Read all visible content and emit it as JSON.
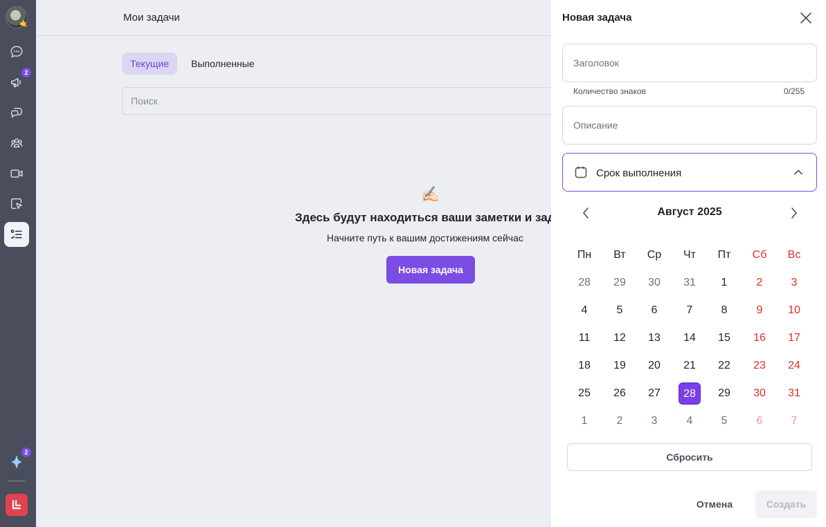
{
  "sidebar": {
    "avatar_badge": "🤙",
    "items": [
      {
        "name": "chat-icon"
      },
      {
        "name": "megaphone-icon",
        "badge": "2"
      },
      {
        "name": "comments-icon"
      },
      {
        "name": "groups-icon"
      },
      {
        "name": "video-icon"
      },
      {
        "name": "pointer-board-icon"
      },
      {
        "name": "tasks-icon",
        "active": true
      }
    ],
    "assistant_badge": "2"
  },
  "main": {
    "title": "Мои задачи",
    "tabs": [
      {
        "label": "Текущие",
        "active": true
      },
      {
        "label": "Выполненные",
        "active": false
      }
    ],
    "search_placeholder": "Поиск",
    "empty": {
      "emoji": "✍🏻",
      "title": "Здесь будут находиться ваши заметки и задачи",
      "subtitle": "Начните путь к вашим достижениям сейчас",
      "button": "Новая задача"
    }
  },
  "panel": {
    "title": "Новая задача",
    "title_placeholder": "Заголовок",
    "char_count_label": "Количество знаков",
    "char_count_value": "0/255",
    "description_placeholder": "Описание",
    "deadline_label": "Срок выполнения",
    "calendar": {
      "month_label": "Август 2025",
      "weekdays": [
        "Пн",
        "Вт",
        "Ср",
        "Чт",
        "Пт",
        "Сб",
        "Вс"
      ],
      "weeks": [
        [
          "28",
          "29",
          "30",
          "31",
          "1",
          "2",
          "3"
        ],
        [
          "4",
          "5",
          "6",
          "7",
          "8",
          "9",
          "10"
        ],
        [
          "11",
          "12",
          "13",
          "14",
          "15",
          "16",
          "17"
        ],
        [
          "18",
          "19",
          "20",
          "21",
          "22",
          "23",
          "24"
        ],
        [
          "25",
          "26",
          "27",
          "28",
          "29",
          "30",
          "31"
        ],
        [
          "1",
          "2",
          "3",
          "4",
          "5",
          "6",
          "7"
        ]
      ],
      "selected": "28",
      "accent_color": "#7a3fe8",
      "weekend_color": "#d93025"
    },
    "reset_label": "Сбросить",
    "cancel_label": "Отмена",
    "create_label": "Создать"
  }
}
